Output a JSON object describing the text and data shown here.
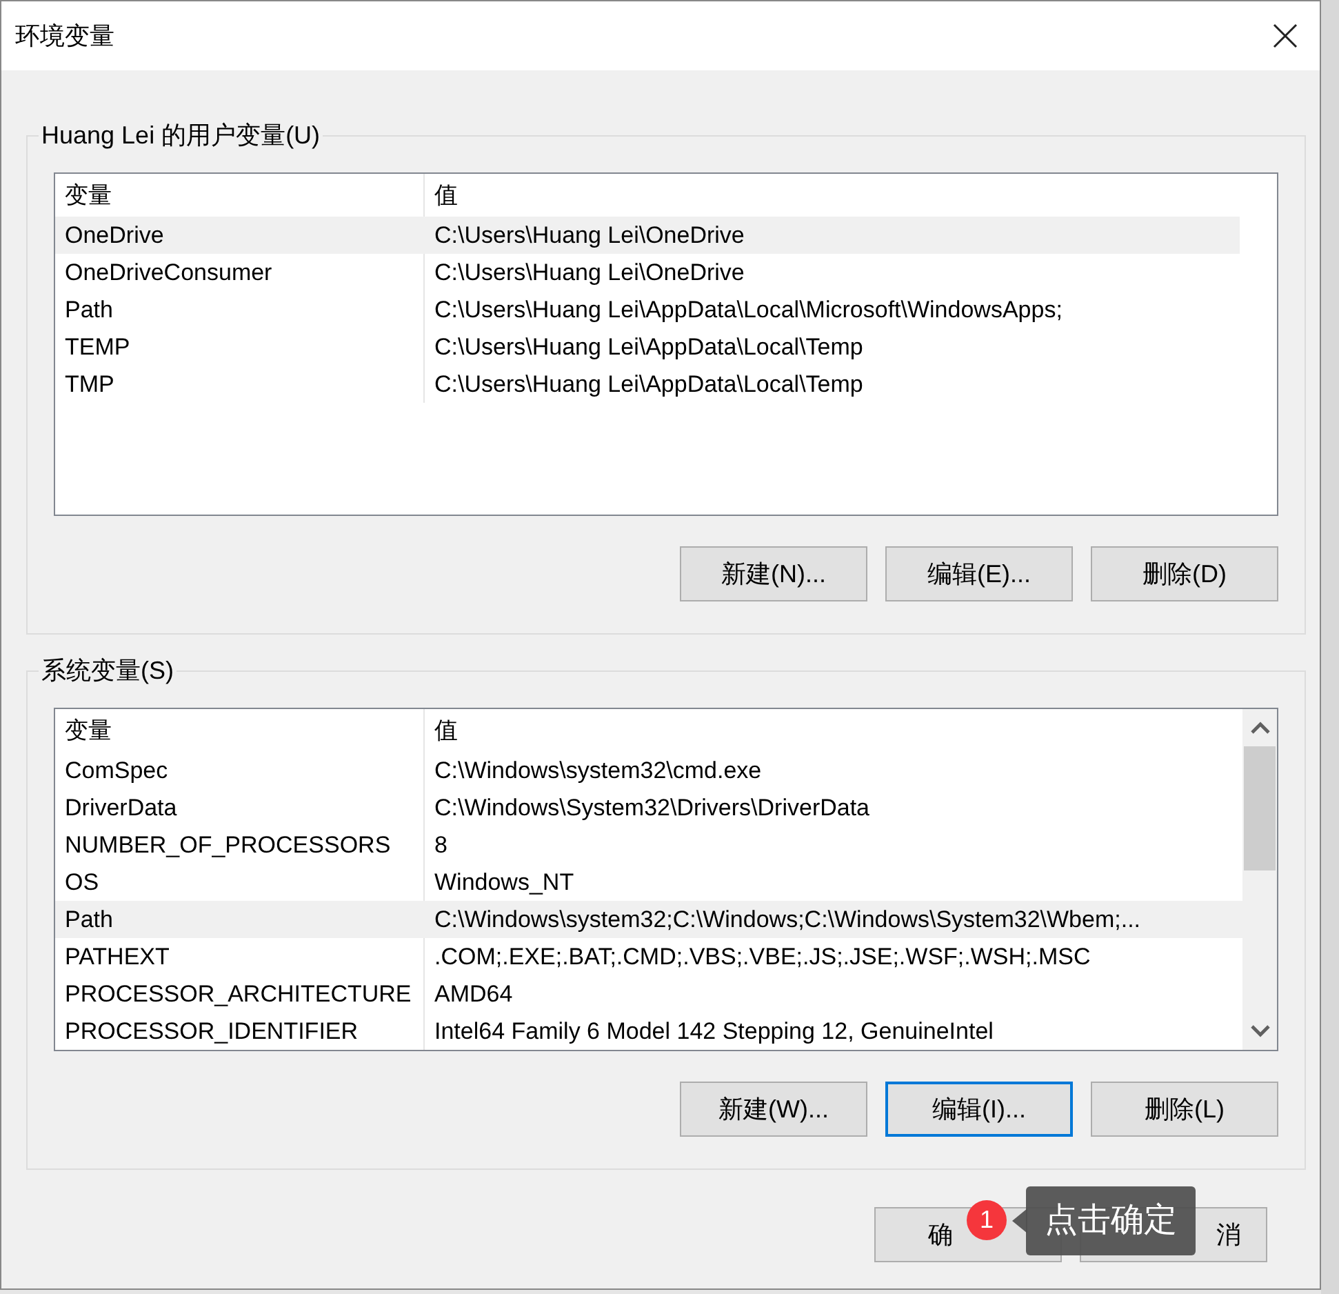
{
  "window": {
    "title": "环境变量"
  },
  "user_variables": {
    "label": "Huang Lei 的用户变量(U)",
    "columns": [
      "变量",
      "值"
    ],
    "rows": [
      {
        "variable": "OneDrive",
        "value": "C:\\Users\\Huang Lei\\OneDrive",
        "selected": true
      },
      {
        "variable": "OneDriveConsumer",
        "value": "C:\\Users\\Huang Lei\\OneDrive",
        "selected": false
      },
      {
        "variable": "Path",
        "value": "C:\\Users\\Huang Lei\\AppData\\Local\\Microsoft\\WindowsApps;",
        "selected": false
      },
      {
        "variable": "TEMP",
        "value": "C:\\Users\\Huang Lei\\AppData\\Local\\Temp",
        "selected": false
      },
      {
        "variable": "TMP",
        "value": "C:\\Users\\Huang Lei\\AppData\\Local\\Temp",
        "selected": false
      }
    ],
    "buttons": [
      {
        "label": "新建(N)...",
        "focused": false
      },
      {
        "label": "编辑(E)...",
        "focused": false
      },
      {
        "label": "删除(D)",
        "focused": false
      }
    ]
  },
  "system_variables": {
    "label": "系统变量(S)",
    "columns": [
      "变量",
      "值"
    ],
    "rows": [
      {
        "variable": "ComSpec",
        "value": "C:\\Windows\\system32\\cmd.exe",
        "selected": false
      },
      {
        "variable": "DriverData",
        "value": "C:\\Windows\\System32\\Drivers\\DriverData",
        "selected": false
      },
      {
        "variable": "NUMBER_OF_PROCESSORS",
        "value": "8",
        "selected": false
      },
      {
        "variable": "OS",
        "value": "Windows_NT",
        "selected": false
      },
      {
        "variable": "Path",
        "value": "C:\\Windows\\system32;C:\\Windows;C:\\Windows\\System32\\Wbem;...",
        "selected": true
      },
      {
        "variable": "PATHEXT",
        "value": ".COM;.EXE;.BAT;.CMD;.VBS;.VBE;.JS;.JSE;.WSF;.WSH;.MSC",
        "selected": false
      },
      {
        "variable": "PROCESSOR_ARCHITECTURE",
        "value": "AMD64",
        "selected": false
      },
      {
        "variable": "PROCESSOR_IDENTIFIER",
        "value": "Intel64 Family 6 Model 142 Stepping 12, GenuineIntel",
        "selected": false
      }
    ],
    "buttons": [
      {
        "label": "新建(W)...",
        "focused": false
      },
      {
        "label": "编辑(I)...",
        "focused": true
      },
      {
        "label": "删除(L)",
        "focused": false
      }
    ]
  },
  "dialog_buttons": [
    {
      "label": "确"
    },
    {
      "label": "消"
    }
  ],
  "tooltip": {
    "badge": "1",
    "text": "点击确定"
  }
}
